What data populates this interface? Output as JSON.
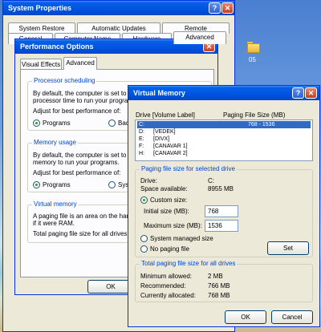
{
  "desktop": {
    "folder_label": "05"
  },
  "sys_props": {
    "title": "System Properties",
    "help": "?",
    "close": "✕",
    "tabs_row1": [
      "System Restore",
      "Automatic Updates",
      "Remote"
    ],
    "tabs_row2": [
      "General",
      "Computer Name",
      "Hardware",
      "Advanced"
    ]
  },
  "perf": {
    "title": "Performance Options",
    "tabs": [
      "Visual Effects",
      "Advanced"
    ],
    "processor": {
      "title": "Processor scheduling",
      "text1": "By default, the computer is set to u",
      "text2": "processor time to run your program",
      "adjust": "Adjust for best performance of:",
      "opt_programs": "Programs",
      "opt_background": "Backgr"
    },
    "memory": {
      "title": "Memory usage",
      "text1": "By default, the computer is set to u",
      "text2": "memory to run your programs.",
      "adjust": "Adjust for best performance of:",
      "opt_programs": "Programs",
      "opt_system": "Syster"
    },
    "virtual": {
      "title": "Virtual memory",
      "text1": "A paging file is an area on the hard",
      "text2": "if it were RAM.",
      "total": "Total paging file size for all drives:"
    },
    "ok": "OK"
  },
  "vm": {
    "title": "Virtual Memory",
    "help": "?",
    "close": "✕",
    "col_drive": "Drive  [Volume Label]",
    "col_size": "Paging File Size (MB)",
    "drives": [
      {
        "drive": "C:",
        "label": "",
        "size": "768 - 1536"
      },
      {
        "drive": "D:",
        "label": "[VEDEK]",
        "size": ""
      },
      {
        "drive": "E:",
        "label": "[DIVX]",
        "size": ""
      },
      {
        "drive": "F:",
        "label": "[CANAVAR 1]",
        "size": ""
      },
      {
        "drive": "H:",
        "label": "[CANAVAR 2]",
        "size": ""
      }
    ],
    "selected": {
      "title": "Paging file size for selected drive",
      "drive_label": "Drive:",
      "drive_value": "C:",
      "space_label": "Space available:",
      "space_value": "8955 MB",
      "custom": "Custom size:",
      "initial_label": "Initial size (MB):",
      "initial_value": "768",
      "max_label": "Maximum size (MB):",
      "max_value": "1536",
      "system_managed": "System managed size",
      "no_paging": "No paging file",
      "set": "Set"
    },
    "totals": {
      "title": "Total paging file size for all drives",
      "min_label": "Minimum allowed:",
      "min_value": "2 MB",
      "rec_label": "Recommended:",
      "rec_value": "766 MB",
      "cur_label": "Currently allocated:",
      "cur_value": "768 MB"
    },
    "ok": "OK",
    "cancel": "Cancel"
  }
}
